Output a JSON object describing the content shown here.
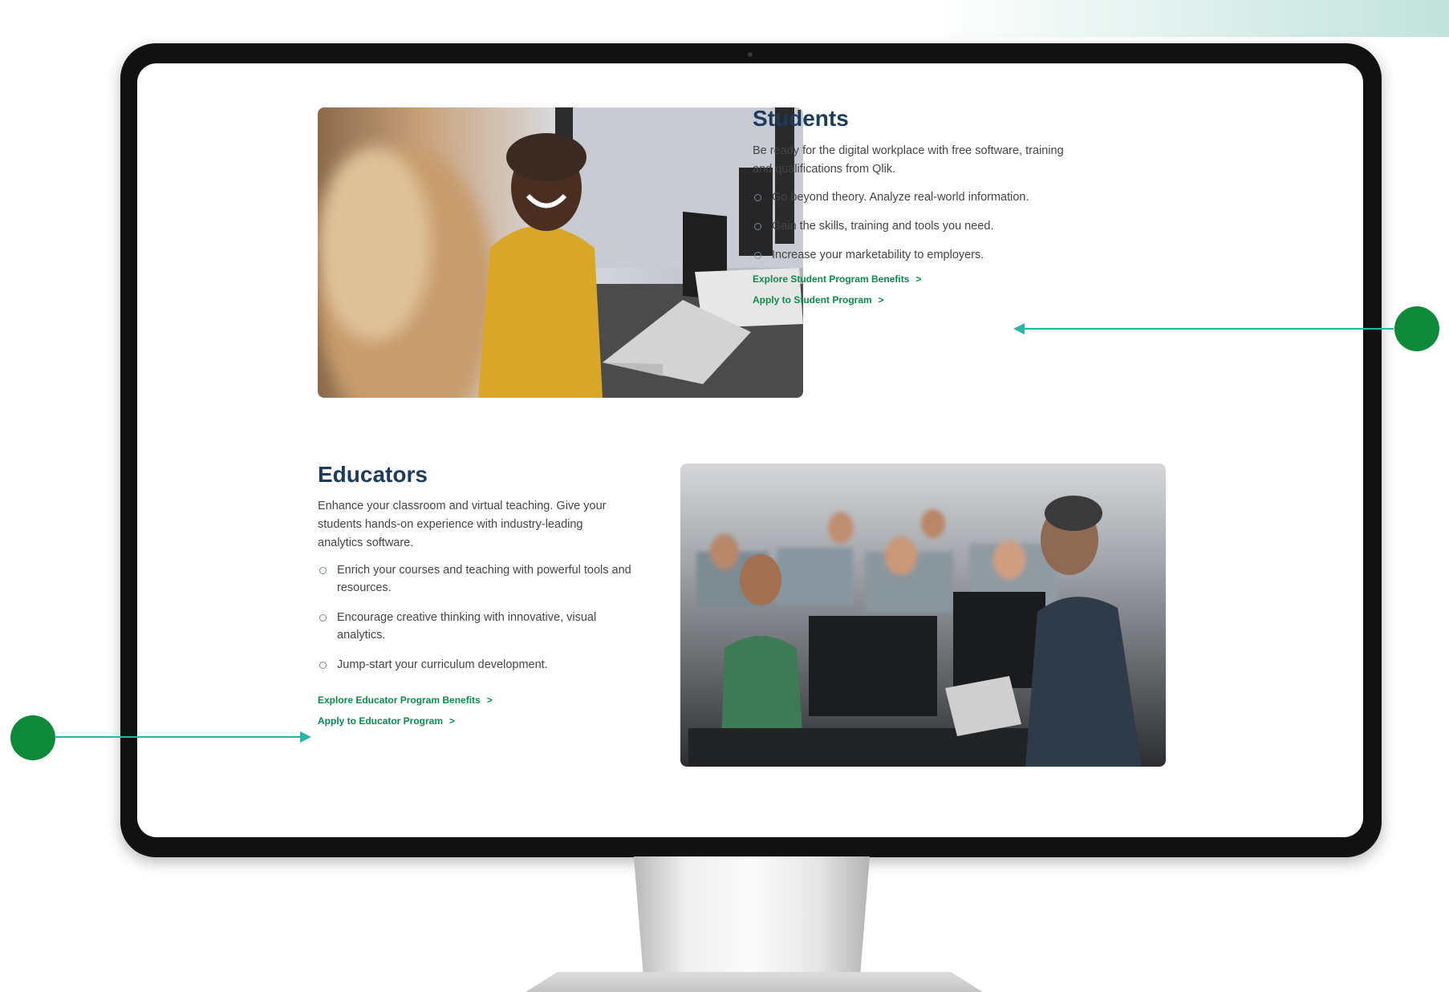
{
  "students": {
    "title": "Students",
    "description": "Be ready for the digital workplace with free software, training and qualifications from Qlik.",
    "bullets": [
      "Go beyond theory. Analyze real-world information.",
      "Gain the skills, training and tools you need.",
      "Increase your marketability to employers."
    ],
    "links": {
      "explore": "Explore Student Program Benefits",
      "apply": "Apply to Student Program"
    }
  },
  "educators": {
    "title": "Educators",
    "description": "Enhance your classroom and virtual teaching. Give your students hands-on experience with industry-leading analytics software.",
    "bullets": [
      "Enrich your courses and teaching with powerful tools and resources.",
      "Encourage creative thinking with innovative, visual analytics.",
      "Jump-start your curriculum development."
    ],
    "links": {
      "explore": "Explore Educator Program Benefits",
      "apply": "Apply to Educator Program"
    }
  },
  "link_chevron": ">",
  "colors": {
    "title": "#1f3b5c",
    "link": "#0c8a4c",
    "callout_dot": "#0f8a3b",
    "callout_line": "#28b6a6"
  },
  "icons": {
    "bullet": "circle-bullet-icon",
    "link_arrow": "chevron-right-icon"
  }
}
